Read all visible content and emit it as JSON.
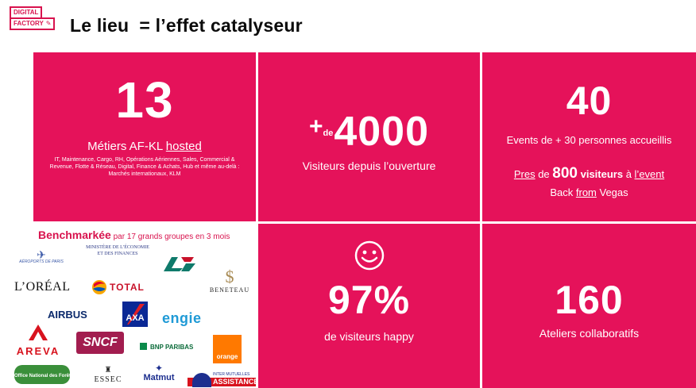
{
  "header": {
    "logo_line1": "DIGITAL",
    "logo_line2": "FACTORY",
    "logo_small": "",
    "title": "Le lieu  = l’effet catalyseur"
  },
  "tile_metiers": {
    "number": "13",
    "label_main": "Métiers AF-KL ",
    "label_underlined": "hosted",
    "detail": "IT, Maintenance, Cargo, RH, Opérations Aériennes, Sales, Commercial & Revenue, Flotte & Réseau, Digital, Finance & Achats, Hub et même au-delà : Marchés internationaux, KLM"
  },
  "tile_visiteurs": {
    "plus": "+",
    "de": "de",
    "number": "4000",
    "label": "Visiteurs depuis l’ouverture"
  },
  "tile_events": {
    "number": "40",
    "label": "Events de + 30 personnes accueillis",
    "line2_pres": "Pres",
    "line2_de": " de ",
    "line2_num": "800",
    "line2_visiteurs": " visiteurs",
    "line2_a": " à ",
    "line2_event": "l’event",
    "line3_back": "Back ",
    "line3_from": "from",
    "line3_vegas": " Vegas"
  },
  "tile_happy": {
    "icon": "smiley-icon",
    "number": "97%",
    "label": "de visiteurs happy"
  },
  "tile_ateliers": {
    "number": "160",
    "label": "Ateliers collaboratifs"
  },
  "benchmark": {
    "title": "Benchmarkée",
    "subtitle": " par 17 grands groupes en 3 mois",
    "logos": {
      "adp": "AÉROPORTS DE PARIS",
      "ministere_line1": "MINISTÈRE DE L’ÉCONOMIE",
      "ministere_line2": "ET DES FINANCES",
      "ca": "CA",
      "loreal": "L’ORÉAL",
      "total": "TOTAL",
      "beneteau": "BENETEAU",
      "airbus": "AIRBUS",
      "axa": "AXA",
      "engie": "engie",
      "areva": "AREVA",
      "sncf": "SNCF",
      "bnp": "BNP PARIBAS",
      "orange": "orange",
      "onf": "Office National des Forêts",
      "essec": "ESSEC",
      "matmut": "Matmut",
      "ima_top": "INTER MUTUELLES",
      "ima_bottom": "ASSISTANCE"
    }
  },
  "colors": {
    "tile_bg": "#e5125a",
    "brand": "#d8134e",
    "text": "#0b0b0b"
  }
}
